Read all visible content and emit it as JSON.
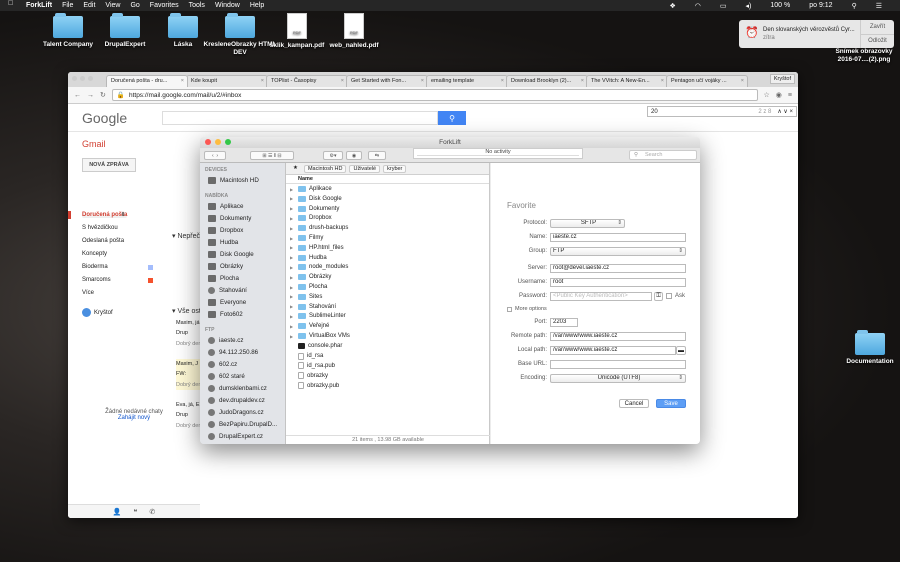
{
  "menubar": {
    "app": "ForkLift",
    "items": [
      "File",
      "Edit",
      "View",
      "Go",
      "Favorites",
      "Tools",
      "Window",
      "Help"
    ],
    "status": {
      "wifi": "WiFi",
      "battery": "100 %",
      "time": "po 9:12",
      "bat_icon": "battery-icon"
    }
  },
  "desktop": {
    "top_icons": [
      {
        "label": "Talent Company",
        "type": "folder"
      },
      {
        "label": "DrupalExpert",
        "type": "folder"
      },
      {
        "label": "Láska",
        "type": "folder"
      },
      {
        "label": "KresleneObrazky HTML DEV",
        "type": "folder"
      },
      {
        "label": "sklik_kampan.pdf",
        "type": "pdf"
      },
      {
        "label": "web_nahled.pdf",
        "type": "pdf"
      }
    ],
    "right_icons": [
      {
        "label": "Snímek obrazovky 2016-07....(2).png",
        "type": "image"
      },
      {
        "label": "Documentation",
        "type": "folder"
      }
    ]
  },
  "notification": {
    "title": "Den slovanských věrozvěstů Cyr...",
    "subtitle": "zítra",
    "close": "Zavřít",
    "snooze": "Odložit"
  },
  "chrome": {
    "tabs": [
      "Doručená pošta - dru...",
      "Kde koupit",
      "TOPlist - Časopisy",
      "Get Started with Fon...",
      "emailing template",
      "Download Brooklyn (2)...",
      "The VVitch: A New-En...",
      "Pentagon učí vojáky ..."
    ],
    "profile": "Kryštof",
    "url": "https://mail.google.com/mail/u/2/#inbox",
    "find_value": "20",
    "find_count": "2 z 8"
  },
  "gmail": {
    "logo": "Google",
    "label": "Gmail",
    "compose": "NOVÁ ZPRÁVA",
    "nav": [
      "Doručená pošta",
      "S hvězdičkou",
      "Odeslaná pošta",
      "Koncepty",
      "Bioderma",
      "Smarcoms",
      "Více"
    ],
    "section1": "Nepřečtené",
    "section2": "Vše ostatní",
    "mails": [
      {
        "from": "Maxim, já",
        "snippet": "Drup",
        "meta": "Dobrý den"
      },
      {
        "from": "Maxim, J",
        "snippet": "FW:",
        "meta": "Dobrý den"
      },
      {
        "from": "Eva, já, E",
        "snippet": "Drup",
        "meta": "Dobrý den"
      }
    ],
    "user": "Kryštof",
    "no_chats": "Žádné nedávné chaty",
    "start_chat": "Zahájit nový"
  },
  "forklift": {
    "title": "ForkLift",
    "activity": "No activity",
    "search_placeholder": "Search",
    "sidebar": {
      "devices_header": "DEVICES",
      "devices": [
        "Macintosh HD"
      ],
      "favorites_header": "NABÍDKA",
      "favorites": [
        "Aplikace",
        "Dokumenty",
        "Dropbox",
        "Hudba",
        "Disk Google",
        "Obrázky",
        "Plocha",
        "Stahování",
        "Everyone",
        "Foto602"
      ],
      "ftp_header": "FTP",
      "ftp": [
        "iaeste.cz",
        "94.112.250.86",
        "602.cz",
        "602 staré",
        "dumsklenbami.cz",
        "dev.drupaldev.cz",
        "JudoDragons.cz",
        "BezPapiru.DrupalD...",
        "DrupalExpert.cz"
      ]
    },
    "breadcrumb": [
      "Macintosh HD",
      "Uživatelé",
      "kryber"
    ],
    "column_header": "Name",
    "files": [
      {
        "n": "Aplikace",
        "t": "folder"
      },
      {
        "n": "Disk Google",
        "t": "folder"
      },
      {
        "n": "Dokumenty",
        "t": "folder"
      },
      {
        "n": "Dropbox",
        "t": "folder"
      },
      {
        "n": "drush-backups",
        "t": "folder"
      },
      {
        "n": "Filmy",
        "t": "folder"
      },
      {
        "n": "HP.html_files",
        "t": "folder"
      },
      {
        "n": "Hudba",
        "t": "folder"
      },
      {
        "n": "node_modules",
        "t": "folder"
      },
      {
        "n": "Obrázky",
        "t": "folder"
      },
      {
        "n": "Plocha",
        "t": "folder"
      },
      {
        "n": "Sites",
        "t": "folder"
      },
      {
        "n": "Stahování",
        "t": "folder"
      },
      {
        "n": "SublimeLinter",
        "t": "folder"
      },
      {
        "n": "Veřejné",
        "t": "folder"
      },
      {
        "n": "VirtualBox VMs",
        "t": "folder"
      },
      {
        "n": "console.phar",
        "t": "term"
      },
      {
        "n": "id_rsa",
        "t": "doc"
      },
      {
        "n": "id_rsa.pub",
        "t": "doc"
      },
      {
        "n": "obrazky",
        "t": "doc"
      },
      {
        "n": "obrazky.pub",
        "t": "doc"
      }
    ],
    "status": "21 items , 13.98 GB available",
    "form": {
      "heading": "Favorite",
      "protocol_label": "Protocol:",
      "protocol": "SFTP",
      "name_label": "Name:",
      "name": "iaeste.cz",
      "group_label": "Group:",
      "group": "FTP",
      "server_label": "Server:",
      "server": "root@devel.iaeste.cz",
      "username_label": "Username:",
      "username": "root",
      "password_label": "Password:",
      "password_placeholder": "<Public Key Authentication>",
      "ask": "Ask",
      "more_options": "More options",
      "port_label": "Port:",
      "port": "2203",
      "remote_label": "Remote path:",
      "remote": "/var/www/www.iaeste.cz",
      "local_label": "Local path:",
      "local": "/var/www/www.iaeste.cz",
      "baseurl_label": "Base URL:",
      "baseurl": "",
      "encoding_label": "Encoding:",
      "encoding": "Unicode (UTF8)",
      "cancel": "Cancel",
      "save": "Save"
    }
  }
}
